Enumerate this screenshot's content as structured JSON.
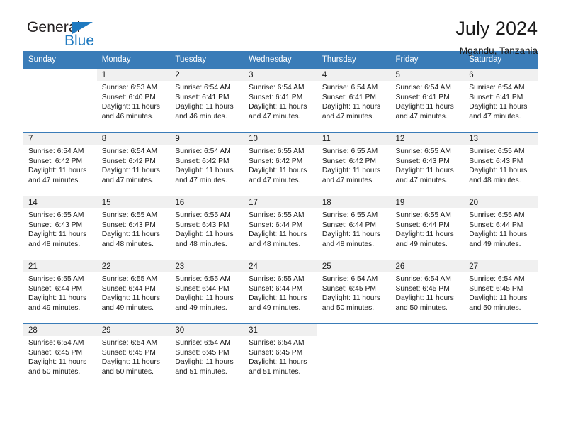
{
  "brand": {
    "name_top": "General",
    "name_bottom": "Blue",
    "triangle_color": "#1f7ac0"
  },
  "header": {
    "title": "July 2024",
    "subtitle": "Mgandu, Tanzania"
  },
  "theme": {
    "header_blue": "#3a7cb8",
    "daynum_band": "#f0f0f0",
    "text": "#1a1a1a"
  },
  "weekday_headers": [
    "Sunday",
    "Monday",
    "Tuesday",
    "Wednesday",
    "Thursday",
    "Friday",
    "Saturday"
  ],
  "labels": {
    "sunrise_prefix": "Sunrise:",
    "sunset_prefix": "Sunset:",
    "daylight_prefix": "Daylight:"
  },
  "weeks": [
    [
      {
        "empty": true
      },
      {
        "day": "1",
        "sunrise": "Sunrise: 6:53 AM",
        "sunset": "Sunset: 6:40 PM",
        "daylight_1": "Daylight: 11 hours",
        "daylight_2": "and 46 minutes."
      },
      {
        "day": "2",
        "sunrise": "Sunrise: 6:54 AM",
        "sunset": "Sunset: 6:41 PM",
        "daylight_1": "Daylight: 11 hours",
        "daylight_2": "and 46 minutes."
      },
      {
        "day": "3",
        "sunrise": "Sunrise: 6:54 AM",
        "sunset": "Sunset: 6:41 PM",
        "daylight_1": "Daylight: 11 hours",
        "daylight_2": "and 47 minutes."
      },
      {
        "day": "4",
        "sunrise": "Sunrise: 6:54 AM",
        "sunset": "Sunset: 6:41 PM",
        "daylight_1": "Daylight: 11 hours",
        "daylight_2": "and 47 minutes."
      },
      {
        "day": "5",
        "sunrise": "Sunrise: 6:54 AM",
        "sunset": "Sunset: 6:41 PM",
        "daylight_1": "Daylight: 11 hours",
        "daylight_2": "and 47 minutes."
      },
      {
        "day": "6",
        "sunrise": "Sunrise: 6:54 AM",
        "sunset": "Sunset: 6:41 PM",
        "daylight_1": "Daylight: 11 hours",
        "daylight_2": "and 47 minutes."
      }
    ],
    [
      {
        "day": "7",
        "sunrise": "Sunrise: 6:54 AM",
        "sunset": "Sunset: 6:42 PM",
        "daylight_1": "Daylight: 11 hours",
        "daylight_2": "and 47 minutes."
      },
      {
        "day": "8",
        "sunrise": "Sunrise: 6:54 AM",
        "sunset": "Sunset: 6:42 PM",
        "daylight_1": "Daylight: 11 hours",
        "daylight_2": "and 47 minutes."
      },
      {
        "day": "9",
        "sunrise": "Sunrise: 6:54 AM",
        "sunset": "Sunset: 6:42 PM",
        "daylight_1": "Daylight: 11 hours",
        "daylight_2": "and 47 minutes."
      },
      {
        "day": "10",
        "sunrise": "Sunrise: 6:55 AM",
        "sunset": "Sunset: 6:42 PM",
        "daylight_1": "Daylight: 11 hours",
        "daylight_2": "and 47 minutes."
      },
      {
        "day": "11",
        "sunrise": "Sunrise: 6:55 AM",
        "sunset": "Sunset: 6:42 PM",
        "daylight_1": "Daylight: 11 hours",
        "daylight_2": "and 47 minutes."
      },
      {
        "day": "12",
        "sunrise": "Sunrise: 6:55 AM",
        "sunset": "Sunset: 6:43 PM",
        "daylight_1": "Daylight: 11 hours",
        "daylight_2": "and 47 minutes."
      },
      {
        "day": "13",
        "sunrise": "Sunrise: 6:55 AM",
        "sunset": "Sunset: 6:43 PM",
        "daylight_1": "Daylight: 11 hours",
        "daylight_2": "and 48 minutes."
      }
    ],
    [
      {
        "day": "14",
        "sunrise": "Sunrise: 6:55 AM",
        "sunset": "Sunset: 6:43 PM",
        "daylight_1": "Daylight: 11 hours",
        "daylight_2": "and 48 minutes."
      },
      {
        "day": "15",
        "sunrise": "Sunrise: 6:55 AM",
        "sunset": "Sunset: 6:43 PM",
        "daylight_1": "Daylight: 11 hours",
        "daylight_2": "and 48 minutes."
      },
      {
        "day": "16",
        "sunrise": "Sunrise: 6:55 AM",
        "sunset": "Sunset: 6:43 PM",
        "daylight_1": "Daylight: 11 hours",
        "daylight_2": "and 48 minutes."
      },
      {
        "day": "17",
        "sunrise": "Sunrise: 6:55 AM",
        "sunset": "Sunset: 6:44 PM",
        "daylight_1": "Daylight: 11 hours",
        "daylight_2": "and 48 minutes."
      },
      {
        "day": "18",
        "sunrise": "Sunrise: 6:55 AM",
        "sunset": "Sunset: 6:44 PM",
        "daylight_1": "Daylight: 11 hours",
        "daylight_2": "and 48 minutes."
      },
      {
        "day": "19",
        "sunrise": "Sunrise: 6:55 AM",
        "sunset": "Sunset: 6:44 PM",
        "daylight_1": "Daylight: 11 hours",
        "daylight_2": "and 49 minutes."
      },
      {
        "day": "20",
        "sunrise": "Sunrise: 6:55 AM",
        "sunset": "Sunset: 6:44 PM",
        "daylight_1": "Daylight: 11 hours",
        "daylight_2": "and 49 minutes."
      }
    ],
    [
      {
        "day": "21",
        "sunrise": "Sunrise: 6:55 AM",
        "sunset": "Sunset: 6:44 PM",
        "daylight_1": "Daylight: 11 hours",
        "daylight_2": "and 49 minutes."
      },
      {
        "day": "22",
        "sunrise": "Sunrise: 6:55 AM",
        "sunset": "Sunset: 6:44 PM",
        "daylight_1": "Daylight: 11 hours",
        "daylight_2": "and 49 minutes."
      },
      {
        "day": "23",
        "sunrise": "Sunrise: 6:55 AM",
        "sunset": "Sunset: 6:44 PM",
        "daylight_1": "Daylight: 11 hours",
        "daylight_2": "and 49 minutes."
      },
      {
        "day": "24",
        "sunrise": "Sunrise: 6:55 AM",
        "sunset": "Sunset: 6:44 PM",
        "daylight_1": "Daylight: 11 hours",
        "daylight_2": "and 49 minutes."
      },
      {
        "day": "25",
        "sunrise": "Sunrise: 6:54 AM",
        "sunset": "Sunset: 6:45 PM",
        "daylight_1": "Daylight: 11 hours",
        "daylight_2": "and 50 minutes."
      },
      {
        "day": "26",
        "sunrise": "Sunrise: 6:54 AM",
        "sunset": "Sunset: 6:45 PM",
        "daylight_1": "Daylight: 11 hours",
        "daylight_2": "and 50 minutes."
      },
      {
        "day": "27",
        "sunrise": "Sunrise: 6:54 AM",
        "sunset": "Sunset: 6:45 PM",
        "daylight_1": "Daylight: 11 hours",
        "daylight_2": "and 50 minutes."
      }
    ],
    [
      {
        "day": "28",
        "sunrise": "Sunrise: 6:54 AM",
        "sunset": "Sunset: 6:45 PM",
        "daylight_1": "Daylight: 11 hours",
        "daylight_2": "and 50 minutes."
      },
      {
        "day": "29",
        "sunrise": "Sunrise: 6:54 AM",
        "sunset": "Sunset: 6:45 PM",
        "daylight_1": "Daylight: 11 hours",
        "daylight_2": "and 50 minutes."
      },
      {
        "day": "30",
        "sunrise": "Sunrise: 6:54 AM",
        "sunset": "Sunset: 6:45 PM",
        "daylight_1": "Daylight: 11 hours",
        "daylight_2": "and 51 minutes."
      },
      {
        "day": "31",
        "sunrise": "Sunrise: 6:54 AM",
        "sunset": "Sunset: 6:45 PM",
        "daylight_1": "Daylight: 11 hours",
        "daylight_2": "and 51 minutes."
      },
      {
        "empty": true
      },
      {
        "empty": true
      },
      {
        "empty": true
      }
    ]
  ]
}
